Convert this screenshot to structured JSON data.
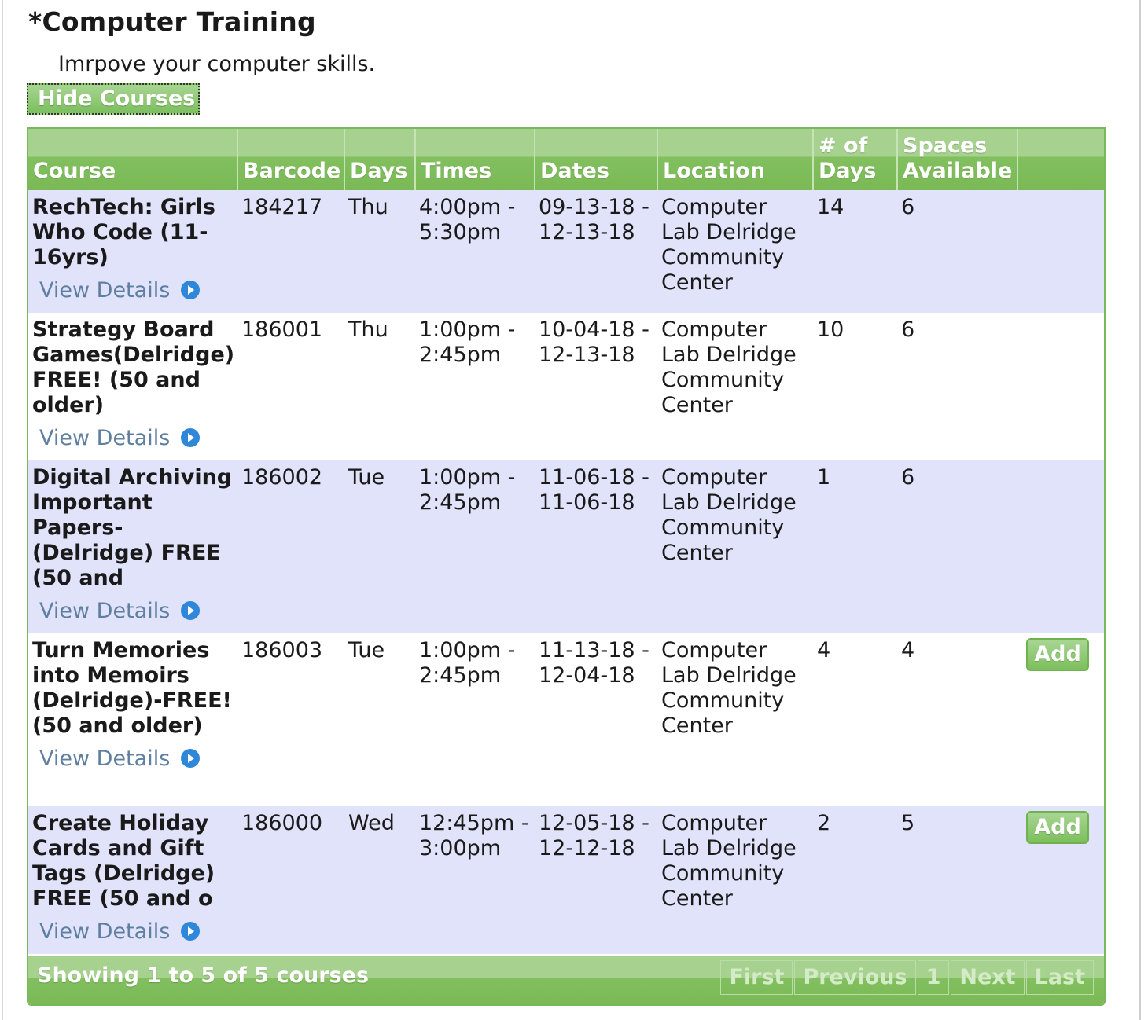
{
  "section": {
    "title": "*Computer Training",
    "subtitle": "Imrpove your computer skills.",
    "toggle_label": "Hide Courses"
  },
  "table": {
    "headers": {
      "course": "Course",
      "barcode": "Barcode",
      "days": "Days",
      "times": "Times",
      "dates": "Dates",
      "location": "Location",
      "num_days": "# of Days",
      "spaces": "Spaces Available"
    },
    "rows": [
      {
        "course": "RechTech: Girls Who Code (11-16yrs)",
        "details_label": "View Details",
        "barcode": "184217",
        "days": "Thu",
        "time_start": "4:00pm -",
        "time_end": "5:30pm",
        "date_start": "09-13-18 -",
        "date_end": "12-13-18",
        "location": "Computer Lab Delridge Community Center",
        "num_days": "14",
        "spaces": "6",
        "add_label": ""
      },
      {
        "course": "Strategy Board Games(Delridge) FREE! (50 and older)",
        "details_label": "View Details",
        "barcode": "186001",
        "days": "Thu",
        "time_start": "1:00pm -",
        "time_end": "2:45pm",
        "date_start": "10-04-18 -",
        "date_end": "12-13-18",
        "location": "Computer Lab Delridge Community Center",
        "num_days": "10",
        "spaces": "6",
        "add_label": ""
      },
      {
        "course": "Digital Archiving Important Papers-(Delridge) FREE (50 and",
        "details_label": "View Details",
        "barcode": "186002",
        "days": "Tue",
        "time_start": "1:00pm -",
        "time_end": "2:45pm",
        "date_start": "11-06-18 -",
        "date_end": "11-06-18",
        "location": "Computer Lab Delridge Community Center",
        "num_days": "1",
        "spaces": "6",
        "add_label": ""
      },
      {
        "course": "Turn Memories into Memoirs (Delridge)-FREE! (50 and older)",
        "details_label": "View Details",
        "barcode": "186003",
        "days": "Tue",
        "time_start": "1:00pm -",
        "time_end": "2:45pm",
        "date_start": "11-13-18 -",
        "date_end": "12-04-18",
        "location": "Computer Lab Delridge Community Center",
        "num_days": "4",
        "spaces": "4",
        "add_label": "Add"
      },
      {
        "course": "Create Holiday Cards and Gift Tags (Delridge) FREE (50 and o",
        "details_label": "View Details",
        "barcode": "186000",
        "days": "Wed",
        "time_start": "12:45pm -",
        "time_end": "3:00pm",
        "date_start": "12-05-18 -",
        "date_end": "12-12-18",
        "location": "Computer Lab Delridge Community Center",
        "num_days": "2",
        "spaces": "5",
        "add_label": "Add"
      }
    ]
  },
  "footer": {
    "showing": "Showing 1 to 5 of 5 courses",
    "pager": {
      "first": "First",
      "previous": "Previous",
      "page": "1",
      "next": "Next",
      "last": "Last"
    }
  },
  "colors": {
    "header_green": "#7ab956",
    "row_alt": "#e1e3fb",
    "link": "#5f7fa1",
    "icon_blue": "#2f87d9"
  },
  "icons": {
    "details": "circle-play-icon"
  }
}
